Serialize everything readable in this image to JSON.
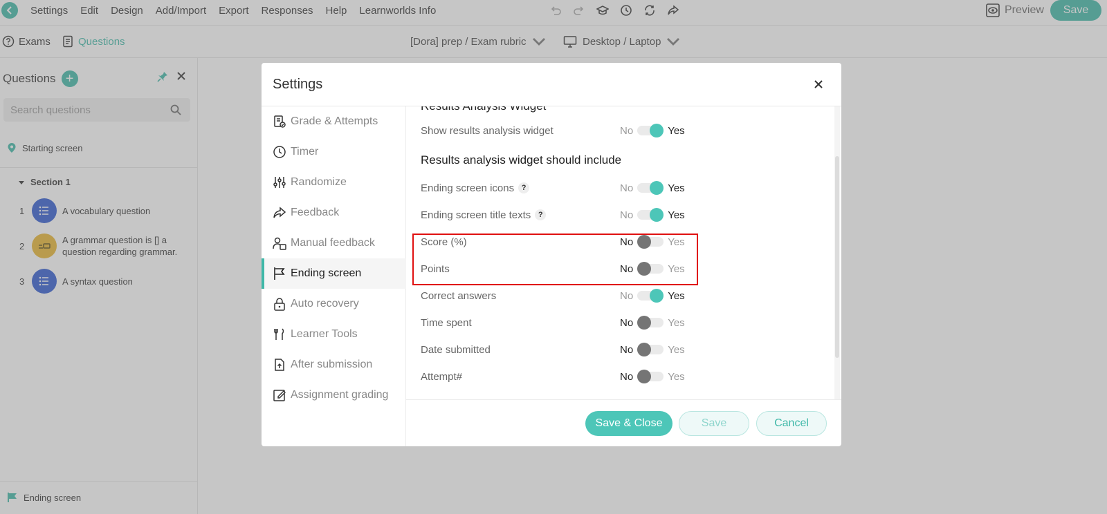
{
  "topbar": {
    "menu": [
      "Settings",
      "Edit",
      "Design",
      "Add/Import",
      "Export",
      "Responses",
      "Help",
      "Learnworlds Info"
    ],
    "preview_label": "Preview",
    "save_label": "Save"
  },
  "subbar": {
    "tab_exams": "Exams",
    "tab_questions": "Questions",
    "exam_dropdown": "[Dora] prep / Exam rubric",
    "device_dropdown": "Desktop / Laptop"
  },
  "left_panel": {
    "title": "Questions",
    "search_placeholder": "Search questions",
    "starting_screen": "Starting screen",
    "section_label": "Section 1",
    "questions": [
      {
        "num": "1",
        "text": "A vocabulary question"
      },
      {
        "num": "2",
        "text": "A grammar question is [] a question regarding grammar."
      },
      {
        "num": "3",
        "text": "A syntax question"
      }
    ],
    "ending_screen": "Ending screen"
  },
  "modal": {
    "title": "Settings",
    "nav": [
      {
        "label": "Grade & Attempts",
        "icon": "grade-icon"
      },
      {
        "label": "Timer",
        "icon": "clock-icon"
      },
      {
        "label": "Randomize",
        "icon": "sliders-icon"
      },
      {
        "label": "Feedback",
        "icon": "share-arrow-icon"
      },
      {
        "label": "Manual feedback",
        "icon": "users-feedback-icon"
      },
      {
        "label": "Ending screen",
        "icon": "flag-icon"
      },
      {
        "label": "Auto recovery",
        "icon": "lock-icon"
      },
      {
        "label": "Learner Tools",
        "icon": "tools-icon"
      },
      {
        "label": "After submission",
        "icon": "file-upload-icon"
      },
      {
        "label": "Assignment grading",
        "icon": "edit-square-icon"
      }
    ],
    "active_nav": "Ending screen",
    "cut_heading": "Results Analysis Widget",
    "show_widget": {
      "label": "Show results analysis widget",
      "value": "Yes"
    },
    "include_heading": "Results analysis widget should include",
    "options": [
      {
        "label": "Ending screen icons",
        "help": "?",
        "value": "Yes"
      },
      {
        "label": "Ending screen title texts",
        "help": "?",
        "value": "Yes"
      },
      {
        "label": "Score (%)",
        "value": "No"
      },
      {
        "label": "Points",
        "value": "No"
      },
      {
        "label": "Correct answers",
        "value": "Yes"
      },
      {
        "label": "Time spent",
        "value": "No"
      },
      {
        "label": "Date submitted",
        "value": "No"
      },
      {
        "label": "Attempt#",
        "value": "No"
      }
    ],
    "toggle_no": "No",
    "toggle_yes": "Yes",
    "buttons": {
      "save_close": "Save & Close",
      "save": "Save",
      "cancel": "Cancel"
    }
  },
  "colors": {
    "accent": "#3fb8a8",
    "toggle_on": "#4dc6b8",
    "highlight": "#e01010"
  }
}
